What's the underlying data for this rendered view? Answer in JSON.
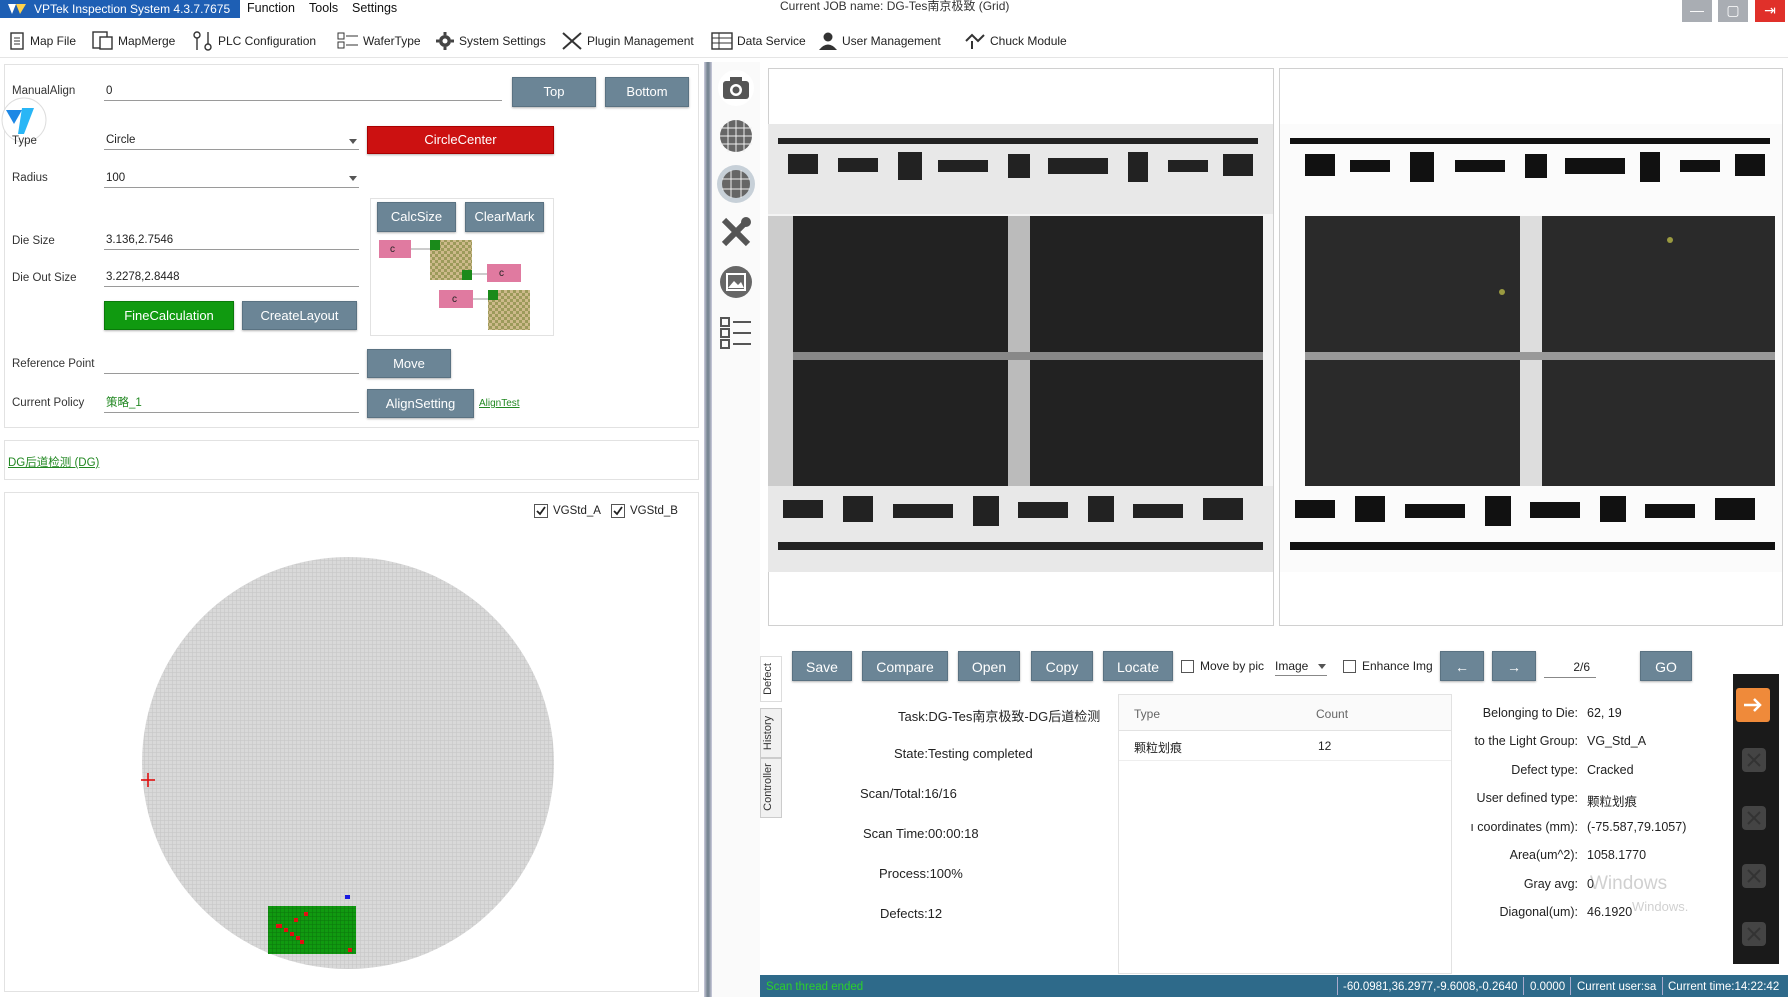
{
  "titlebar": {
    "app_title": "VPTek Inspection System 4.3.7.7675",
    "menus": [
      "Function",
      "Tools",
      "Settings"
    ],
    "job_name": "Current JOB name: DG-Tes南京极致 (Grid)"
  },
  "toolbar": {
    "items": [
      "Map File",
      "MapMerge",
      "PLC Configuration",
      "WaferType",
      "System Settings",
      "Plugin Management",
      "Data Service",
      "User Management",
      "Chuck Module"
    ]
  },
  "align_panel": {
    "manual_align_label": "ManualAlign",
    "manual_align_value": "0",
    "top_button": "Top",
    "bottom_button": "Bottom",
    "type_label": "Type",
    "type_value": "Circle",
    "circle_center_button": "CircleCenter",
    "radius_label": "Radius",
    "radius_value": "100",
    "calcsize_button": "CalcSize",
    "clearmark_button": "ClearMark",
    "mark_letter": "c",
    "die_size_label": "Die Size",
    "die_size_value": "3.136,2.7546",
    "die_out_size_label": "Die Out Size",
    "die_out_size_value": "3.2278,2.8448",
    "fine_calc_button": "FineCalculation",
    "create_layout_button": "CreateLayout",
    "ref_point_label": "Reference Point",
    "ref_point_value": "",
    "move_button": "Move",
    "policy_label": "Current Policy",
    "policy_value": "策略_1",
    "align_setting_button": "AlignSetting",
    "align_test_link": "AlignTest"
  },
  "recipe": {
    "link": "DG后道检测 (DG)"
  },
  "wafer_map": {
    "legend": [
      {
        "label": "VGStd_A",
        "checked": true
      },
      {
        "label": "VGStd_B",
        "checked": true
      }
    ],
    "colors": {
      "die": "#d9d9d9",
      "pass": "#109a10",
      "defect": "#e01010",
      "marker": "#e01010"
    }
  },
  "viewer": {
    "buttons": [
      "Save",
      "Compare",
      "Open",
      "Copy",
      "Locate"
    ],
    "move_by_pic_label": "Move by pic",
    "image_select": "Image",
    "enhance_label": "Enhance Img",
    "prev_arrow": "←",
    "next_arrow": "→",
    "page": "2/6",
    "go_button": "GO"
  },
  "side_tabs": [
    "Defect",
    "History",
    "Controller"
  ],
  "task": {
    "task": "Task:DG-Tes南京极致-DG后道检测",
    "state": "State:Testing completed",
    "scan_total": "Scan/Total:16/16",
    "scan_time": "Scan Time:00:00:18",
    "process": "Process:100%",
    "defects": "Defects:12"
  },
  "defect_table": {
    "headers": [
      "Type",
      "Count"
    ],
    "rows": [
      [
        "颗粒划痕",
        "12"
      ]
    ]
  },
  "defect_info": {
    "rows": [
      {
        "label": "Belonging to Die:",
        "value": "62, 19"
      },
      {
        "label": "to the Light Group:",
        "value": "VG_Std_A"
      },
      {
        "label": "Defect type:",
        "value": "Cracked"
      },
      {
        "label": "User defined type:",
        "value": "颗粒划痕"
      },
      {
        "label": "ı coordinates (mm):",
        "value": "(-75.587,79.1057)"
      },
      {
        "label": "Area(um^2):",
        "value": "1058.1770"
      },
      {
        "label": "Gray avg:",
        "value": "0"
      },
      {
        "label": "Diagonal(um):",
        "value": "46.1920"
      }
    ],
    "watermark_1": "Windows",
    "watermark_2": "Windows."
  },
  "statusbar": {
    "left": "Scan thread ended",
    "coords": "-60.0981,36.2977,-9.6008,-0.2640",
    "value": "0.0000",
    "user": "Current user:sa",
    "time": "Current time:14:22:42"
  }
}
